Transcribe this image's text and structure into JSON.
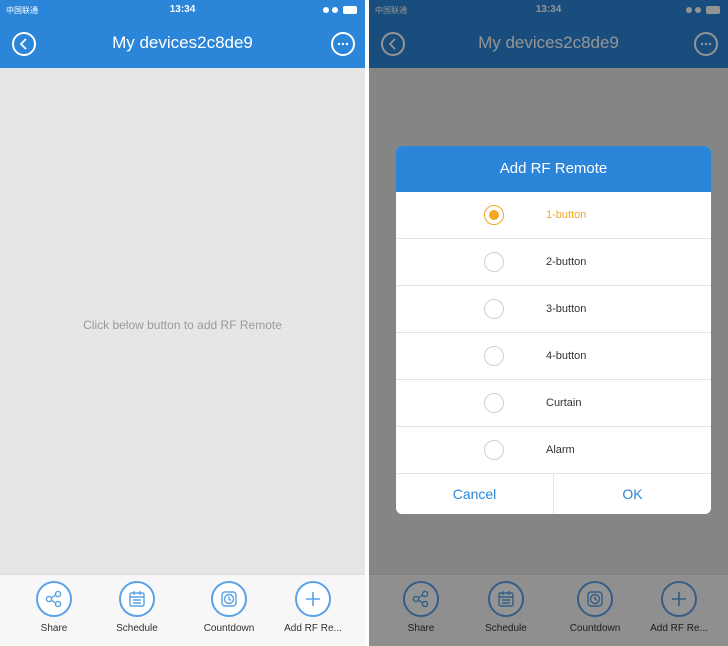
{
  "status": {
    "time": "13:34",
    "carrier": "中国联通"
  },
  "nav": {
    "title": "My devices2c8de9"
  },
  "empty_message": "Click below button to add RF Remote",
  "tabs": [
    {
      "label": "Share",
      "icon": "share-icon"
    },
    {
      "label": "Schedule",
      "icon": "calendar-icon"
    },
    {
      "label": "Countdown",
      "icon": "clock-icon"
    },
    {
      "label": "Add RF Re...",
      "icon": "plus-icon"
    }
  ],
  "dialog": {
    "title": "Add RF Remote",
    "options": [
      {
        "label": "1-button",
        "selected": true
      },
      {
        "label": "2-button",
        "selected": false
      },
      {
        "label": "3-button",
        "selected": false
      },
      {
        "label": "4-button",
        "selected": false
      },
      {
        "label": "Curtain",
        "selected": false
      },
      {
        "label": "Alarm",
        "selected": false
      }
    ],
    "cancel": "Cancel",
    "ok": "OK"
  },
  "colors": {
    "brand": "#2b86d9",
    "accent": "#f5a524"
  }
}
